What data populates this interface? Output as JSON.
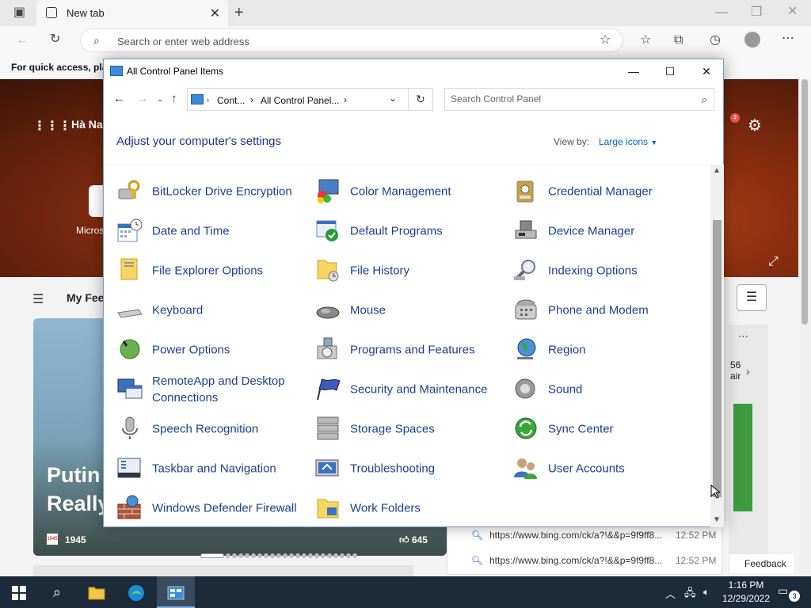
{
  "browser": {
    "tab_title": "New tab",
    "address_placeholder": "Search or enter web address",
    "favbar_text": "For quick access, plac",
    "hero_location": "Hà Na",
    "hero_tile_label": "Micros",
    "notification_count": "4",
    "my_feed": "My Fee",
    "news_headline_line1": "Putin",
    "news_headline_line2": "Really",
    "news_date": "1945",
    "news_date_icon_text": "1945",
    "news_likes": "645",
    "right_card_num": "56",
    "right_card_text": "air",
    "suggestions": [
      {
        "url": "https://www.bing.com/ck/a?!&&p=9f9ff8...",
        "time": "12:52 PM"
      },
      {
        "url": "https://www.bing.com/ck/a?!&&p=9f9ff8...",
        "time": "12:52 PM"
      }
    ],
    "feedback": "Feedback"
  },
  "control_panel": {
    "window_title": "All Control Panel Items",
    "breadcrumb": [
      "Cont...",
      "All Control Panel..."
    ],
    "search_placeholder": "Search Control Panel",
    "heading": "Adjust your computer's settings",
    "view_by_label": "View by:",
    "view_by_value": "Large icons",
    "items": [
      {
        "label": "BitLocker Drive Encryption",
        "icon": "bitlocker-icon"
      },
      {
        "label": "Color Management",
        "icon": "color-management-icon"
      },
      {
        "label": "Credential Manager",
        "icon": "credential-manager-icon"
      },
      {
        "label": "Date and Time",
        "icon": "date-time-icon"
      },
      {
        "label": "Default Programs",
        "icon": "default-programs-icon"
      },
      {
        "label": "Device Manager",
        "icon": "device-manager-icon"
      },
      {
        "label": "File Explorer Options",
        "icon": "folder-options-icon"
      },
      {
        "label": "File History",
        "icon": "file-history-icon"
      },
      {
        "label": "Indexing Options",
        "icon": "indexing-icon"
      },
      {
        "label": "Keyboard",
        "icon": "keyboard-icon"
      },
      {
        "label": "Mouse",
        "icon": "mouse-icon"
      },
      {
        "label": "Phone and Modem",
        "icon": "phone-icon"
      },
      {
        "label": "Power Options",
        "icon": "power-icon"
      },
      {
        "label": "Programs and Features",
        "icon": "programs-icon"
      },
      {
        "label": "Region",
        "icon": "globe-icon"
      },
      {
        "label": "RemoteApp and Desktop Connections",
        "icon": "remote-desktop-icon"
      },
      {
        "label": "Security and Maintenance",
        "icon": "flag-icon"
      },
      {
        "label": "Sound",
        "icon": "speaker-icon"
      },
      {
        "label": "Speech Recognition",
        "icon": "microphone-icon"
      },
      {
        "label": "Storage Spaces",
        "icon": "storage-icon"
      },
      {
        "label": "Sync Center",
        "icon": "sync-icon"
      },
      {
        "label": "Taskbar and Navigation",
        "icon": "taskbar-icon"
      },
      {
        "label": "Troubleshooting",
        "icon": "troubleshoot-icon"
      },
      {
        "label": "User Accounts",
        "icon": "users-icon"
      },
      {
        "label": "Windows Defender Firewall",
        "icon": "firewall-icon"
      },
      {
        "label": "Work Folders",
        "icon": "work-folders-icon"
      }
    ]
  },
  "taskbar": {
    "time": "1:16 PM",
    "date": "12/29/2022",
    "notification_count": "3"
  }
}
